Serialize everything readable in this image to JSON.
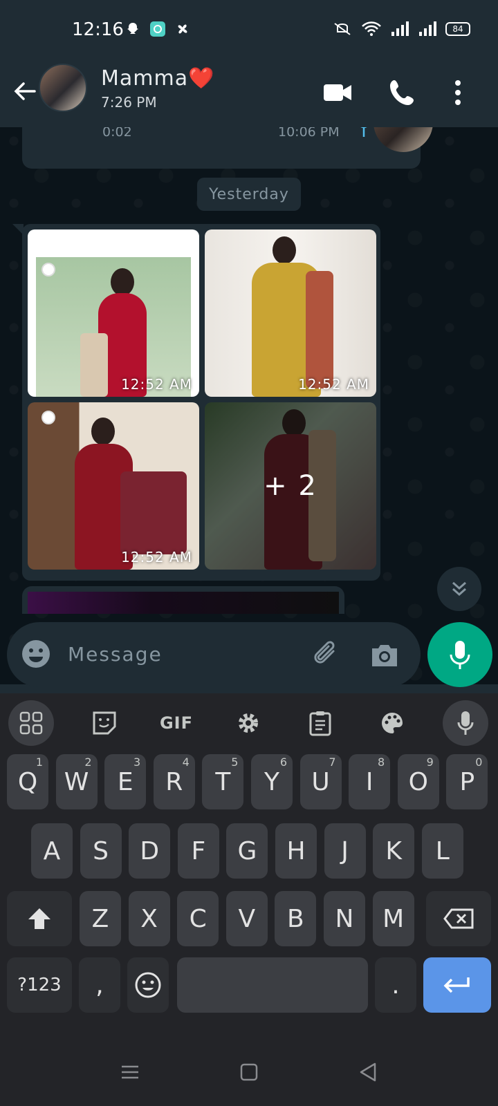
{
  "status_bar": {
    "time": "12:16",
    "battery": "84"
  },
  "header": {
    "contact_name": "Mamma❤️",
    "last_seen": "7:26 PM"
  },
  "voice_message": {
    "duration": "0:02",
    "time": "10:06 PM"
  },
  "date_divider": "Yesterday",
  "gallery": {
    "tiles": [
      {
        "time": "12:52 AM"
      },
      {
        "time": "12:52 AM"
      },
      {
        "time": "12:52 AM"
      },
      {
        "more_label": "+ 2"
      }
    ]
  },
  "composer": {
    "placeholder": "Message"
  },
  "keyboard": {
    "toolbar": {
      "gif_label": "GIF"
    },
    "row1": [
      {
        "label": "Q",
        "hint": "1"
      },
      {
        "label": "W",
        "hint": "2"
      },
      {
        "label": "E",
        "hint": "3"
      },
      {
        "label": "R",
        "hint": "4"
      },
      {
        "label": "T",
        "hint": "5"
      },
      {
        "label": "Y",
        "hint": "6"
      },
      {
        "label": "U",
        "hint": "7"
      },
      {
        "label": "I",
        "hint": "8"
      },
      {
        "label": "O",
        "hint": "9"
      },
      {
        "label": "P",
        "hint": "0"
      }
    ],
    "row2": [
      "A",
      "S",
      "D",
      "F",
      "G",
      "H",
      "J",
      "K",
      "L"
    ],
    "row3": [
      "Z",
      "X",
      "C",
      "V",
      "B",
      "N",
      "M"
    ],
    "symbols_label": "?123",
    "comma": ",",
    "period": "."
  },
  "colors": {
    "accent": "#00a884",
    "enter_key": "#5b95e8",
    "header_bg": "#1f2c34",
    "chat_bg": "#0b141a"
  }
}
